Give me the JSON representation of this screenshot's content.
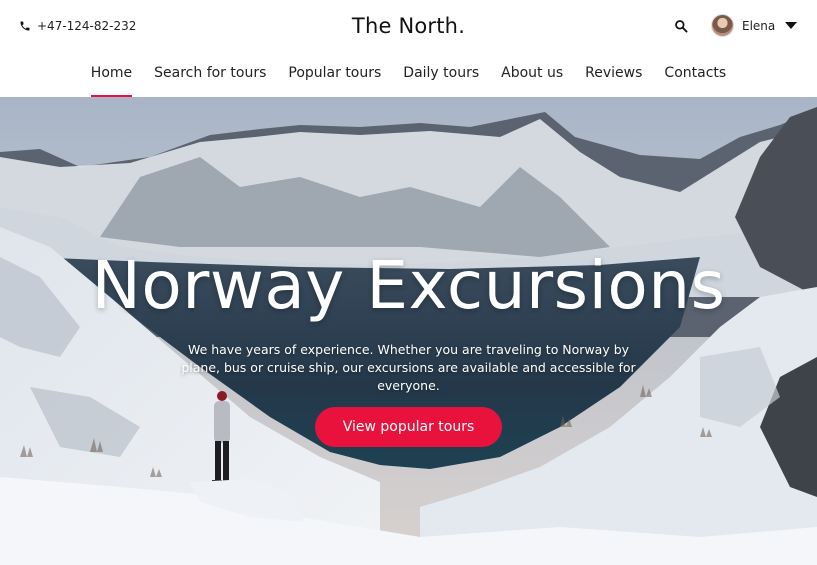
{
  "header": {
    "phone": "+47-124-82-232",
    "brand": "The North.",
    "user_name": "Elena"
  },
  "nav": {
    "items": [
      {
        "label": "Home",
        "active": true
      },
      {
        "label": "Search for tours",
        "active": false
      },
      {
        "label": "Popular tours",
        "active": false
      },
      {
        "label": "Daily tours",
        "active": false
      },
      {
        "label": "About us",
        "active": false
      },
      {
        "label": "Reviews",
        "active": false
      },
      {
        "label": "Contacts",
        "active": false
      }
    ]
  },
  "hero": {
    "title": "Norway Excursions",
    "text": "We have years of experience. Whether you are traveling to Norway by plane, bus or cruise ship, our excursions are available and accessible for everyone.",
    "cta": "View popular tours"
  },
  "colors": {
    "accent": "#e8123d"
  },
  "icons": [
    "phone-icon",
    "search-icon",
    "chevron-down-icon"
  ]
}
